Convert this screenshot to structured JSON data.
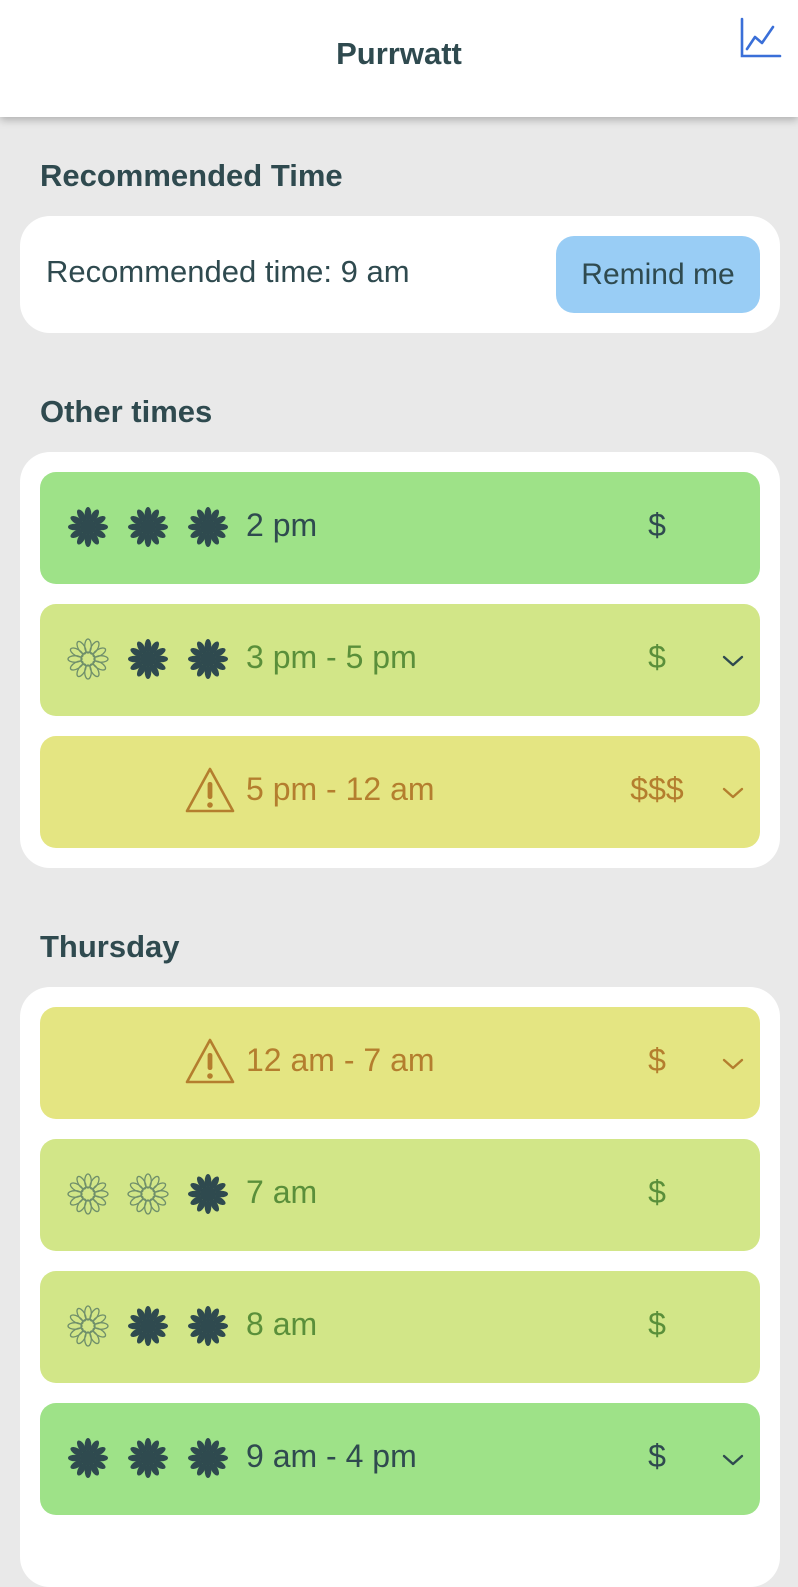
{
  "header": {
    "title": "Purrwatt",
    "chart_icon": "line-chart-icon"
  },
  "recommended": {
    "section_title": "Recommended Time",
    "text": "Recommended time: 9 am",
    "remind_label": "Remind me"
  },
  "other": {
    "section_title": "Other times",
    "slots": [
      {
        "time": "2 pm",
        "price": "$",
        "tone": "green",
        "suns": [
          "full",
          "full",
          "full"
        ],
        "warning": false,
        "expandable": false
      },
      {
        "time": "3 pm - 5 pm",
        "price": "$",
        "tone": "lime",
        "suns": [
          "outline",
          "full",
          "full"
        ],
        "warning": false,
        "expandable": true
      },
      {
        "time": "5 pm - 12 am",
        "price": "$$$",
        "tone": "yellow",
        "suns": [],
        "warning": true,
        "expandable": true
      }
    ]
  },
  "thursday": {
    "section_title": "Thursday",
    "slots": [
      {
        "time": "12 am - 7 am",
        "price": "$",
        "tone": "yellow",
        "suns": [],
        "warning": true,
        "expandable": true
      },
      {
        "time": "7 am",
        "price": "$",
        "tone": "lime",
        "suns": [
          "outline",
          "outline",
          "full"
        ],
        "warning": false,
        "expandable": false
      },
      {
        "time": "8 am",
        "price": "$",
        "tone": "lime",
        "suns": [
          "outline",
          "full",
          "full"
        ],
        "warning": false,
        "expandable": false
      },
      {
        "time": "9 am - 4 pm",
        "price": "$",
        "tone": "green",
        "suns": [
          "full",
          "full",
          "full"
        ],
        "warning": false,
        "expandable": true
      }
    ]
  },
  "colors": {
    "accent": "#99cdf5",
    "green_slot": "#9ee288",
    "lime_slot": "#d2e688",
    "yellow_slot": "#e4e582",
    "text_dark": "#2f4a4f",
    "icon_blue": "#3a6fd8"
  }
}
